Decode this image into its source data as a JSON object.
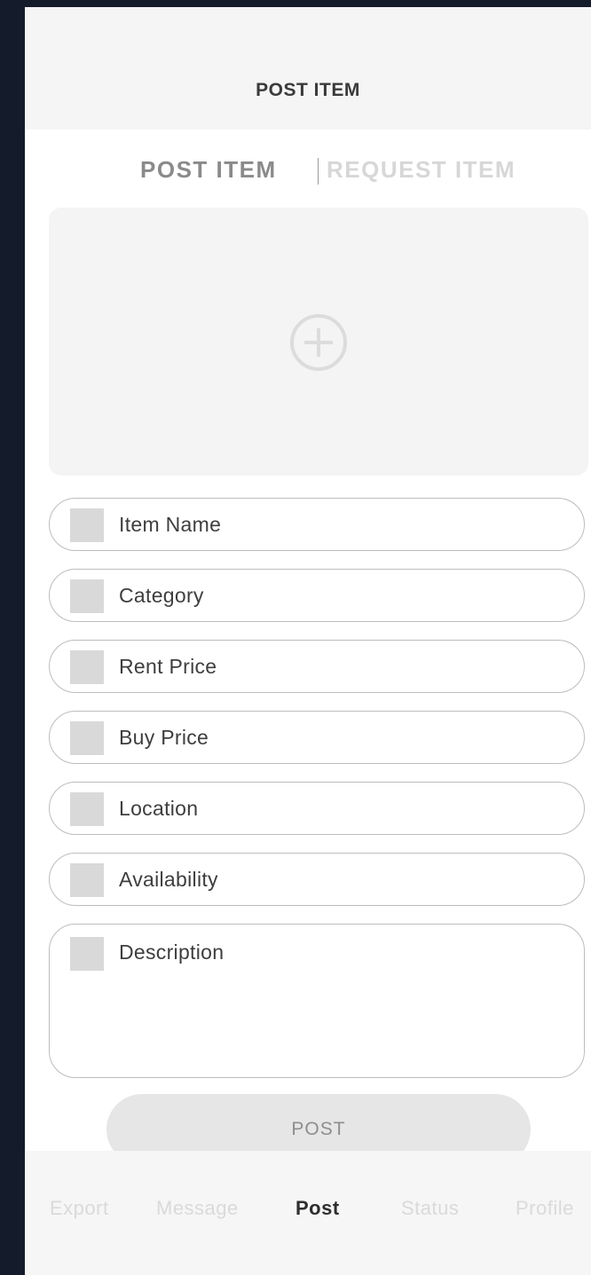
{
  "header": {
    "title": "POST ITEM"
  },
  "segmented_control": {
    "items": [
      {
        "label": "POST ITEM"
      },
      {
        "label": "REQUEST ITEM"
      }
    ]
  },
  "upload": {
    "icon": "add-circle-icon"
  },
  "form": {
    "fields": [
      {
        "label": "Item Name"
      },
      {
        "label": "Category"
      },
      {
        "label": "Rent Price"
      },
      {
        "label": "Buy Price"
      },
      {
        "label": "Location"
      },
      {
        "label": "Availability"
      },
      {
        "label": "Description"
      }
    ],
    "submit_label": "POST"
  },
  "tabbar": {
    "items": [
      {
        "label": "Export"
      },
      {
        "label": "Message"
      },
      {
        "label": "Post"
      },
      {
        "label": "Status"
      },
      {
        "label": "Profile"
      }
    ]
  },
  "colors": {
    "background": "#141c2b",
    "header_bg": "#f5f5f5",
    "placeholder_square": "#d9d9d9",
    "button_bg": "#e6e6e6"
  }
}
